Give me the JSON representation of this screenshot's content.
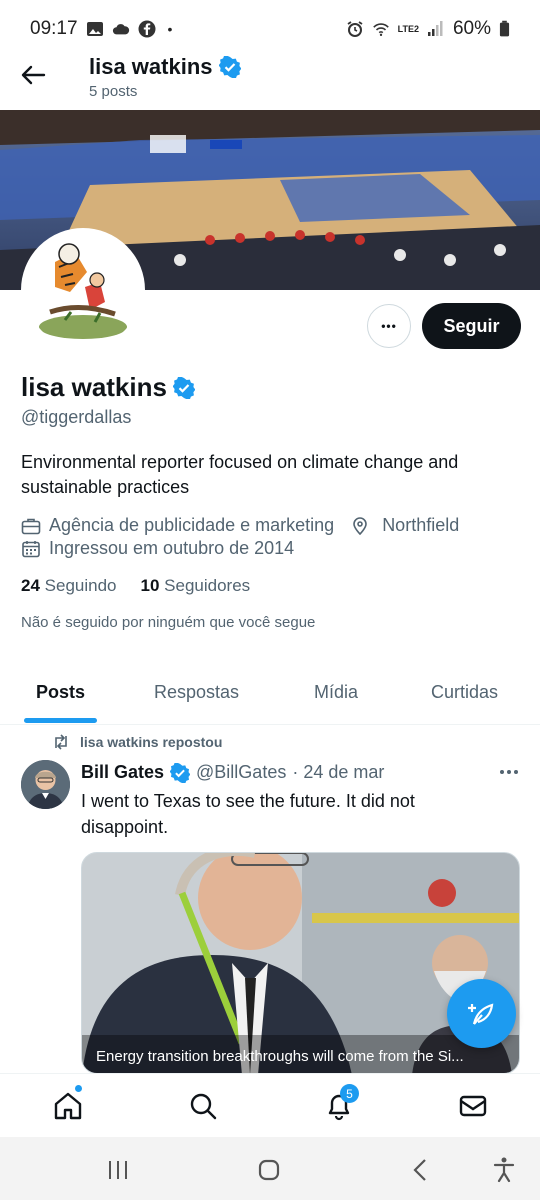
{
  "status_bar": {
    "time": "09:17",
    "dot": "•",
    "network": "LTE2",
    "battery": "60%"
  },
  "header": {
    "name": "lisa watkins",
    "post_count": "5 posts"
  },
  "profile": {
    "display_name": "lisa watkins",
    "handle": "@tiggerdallas",
    "bio": "Environmental reporter focused on climate change and sustainable practices",
    "category": "Agência de publicidade e marketing",
    "location": "Northfield",
    "joined": "Ingressou em outubro de 2014",
    "following_count": "24",
    "following_label": "Seguindo",
    "followers_count": "10",
    "followers_label": "Seguidores",
    "followed_by_note": "Não é seguido por ninguém que você segue",
    "follow_button": "Seguir",
    "more_button": "•••"
  },
  "tabs": [
    {
      "label": "Posts",
      "active": true
    },
    {
      "label": "Respostas",
      "active": false
    },
    {
      "label": "Mídia",
      "active": false
    },
    {
      "label": "Curtidas",
      "active": false
    }
  ],
  "post": {
    "repost_label": "lisa watkins repostou",
    "author_name": "Bill Gates",
    "author_handle": "@BillGates",
    "date": "· 24 de mar",
    "text": "I went to Texas to see the future. It did not disappoint.",
    "media_caption": "Energy transition breakthroughs will come from the Si..."
  },
  "bottom_nav": {
    "notifications_badge": "5"
  },
  "colors": {
    "accent": "#1d9bf0",
    "text": "#0f1419",
    "muted": "#536471"
  }
}
